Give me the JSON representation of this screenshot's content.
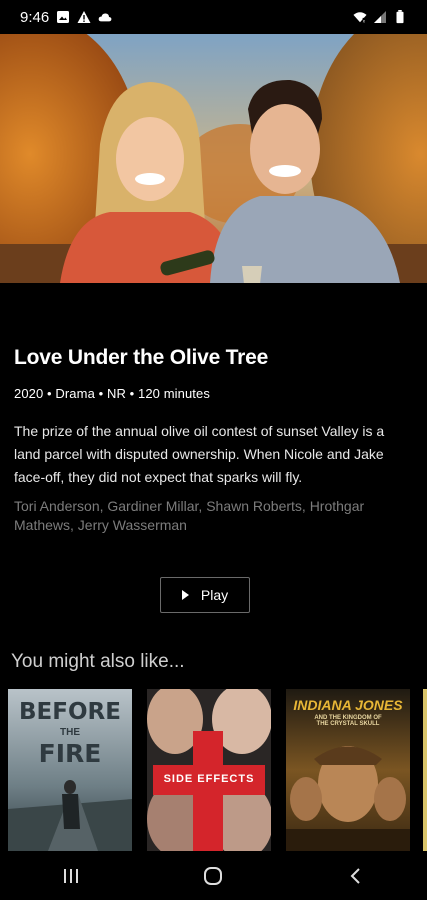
{
  "status_bar": {
    "time": "9:46",
    "icons_left": [
      "image-icon",
      "warning-icon",
      "cloud-icon"
    ],
    "icons_right": [
      "wifi-icon",
      "signal-icon",
      "battery-icon"
    ]
  },
  "movie": {
    "title": "Love Under the Olive Tree",
    "meta": "2020 • Drama • NR • 120 minutes",
    "synopsis": "The prize of the annual olive oil contest of sunset Valley is a land parcel with disputed ownership. When Nicole and Jake face-off, they did not expect that sparks will fly.",
    "cast": "Tori Anderson, Gardiner Millar, Shawn Roberts, Hrothgar Mathews, Jerry Wasserman",
    "play_label": "Play"
  },
  "recommendations": {
    "heading": "You might also like...",
    "items": [
      {
        "line1": "BEFORE",
        "line2": "THE",
        "line3": "FIRE"
      },
      {
        "line1": "SIDE EFFECTS"
      },
      {
        "line1": "INDIANA JONES",
        "line2": "AND THE KINGDOM OF THE CRYSTAL SKULL"
      }
    ]
  },
  "nav": {
    "recent": "recent-apps-icon",
    "home": "home-icon",
    "back": "back-icon"
  },
  "colors": {
    "background": "#000000",
    "muted_text": "#7c7c7c",
    "border": "#6a6a6a"
  }
}
